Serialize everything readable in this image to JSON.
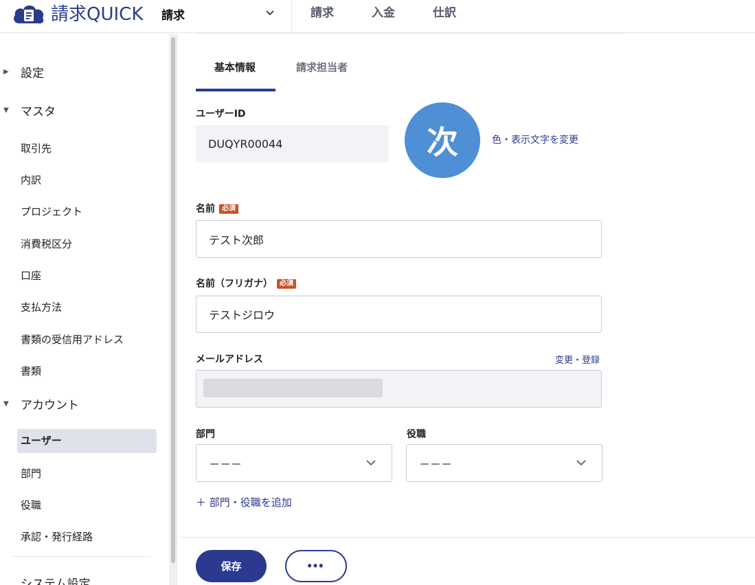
{
  "header": {
    "logo_text": "請求QUICK",
    "app_select_label": "請求",
    "nav": [
      "請求",
      "入金",
      "仕訳"
    ]
  },
  "sidebar": {
    "sections": [
      {
        "label": "設定",
        "expanded": false
      },
      {
        "label": "マスタ",
        "expanded": true
      },
      {
        "label": "アカウント",
        "expanded": true
      },
      {
        "label": "システム設定",
        "expanded": false
      }
    ],
    "master_items": [
      "取引先",
      "内訳",
      "プロジェクト",
      "消費税区分",
      "口座",
      "支払方法",
      "書類の受信用アドレス",
      "書類"
    ],
    "account_items": [
      "ユーザー",
      "部門",
      "役職",
      "承認・発行経路"
    ],
    "active_item": "ユーザー"
  },
  "tabs": [
    {
      "label": "基本情報",
      "active": true
    },
    {
      "label": "請求担当者",
      "active": false
    }
  ],
  "form": {
    "user_id_label": "ユーザーID",
    "user_id_value": "DUQYR00044",
    "avatar_char": "次",
    "avatar_color": "#4e8fd6",
    "avatar_change_link": "色・表示文字を変更",
    "name_label": "名前",
    "required_badge": "必須",
    "name_value": "テスト次郎",
    "kana_label": "名前（フリガナ）",
    "kana_value": "テストジロウ",
    "email_label": "メールアドレス",
    "email_change_link": "変更・登録",
    "department_label": "部門",
    "department_value": "－－－",
    "position_label": "役職",
    "position_value": "－－－",
    "add_link": "＋ 部門・役職を追加"
  },
  "footer": {
    "save_label": "保存",
    "more_label": "•••"
  },
  "colors": {
    "brand": "#2b3a8f",
    "required": "#c7522a"
  }
}
